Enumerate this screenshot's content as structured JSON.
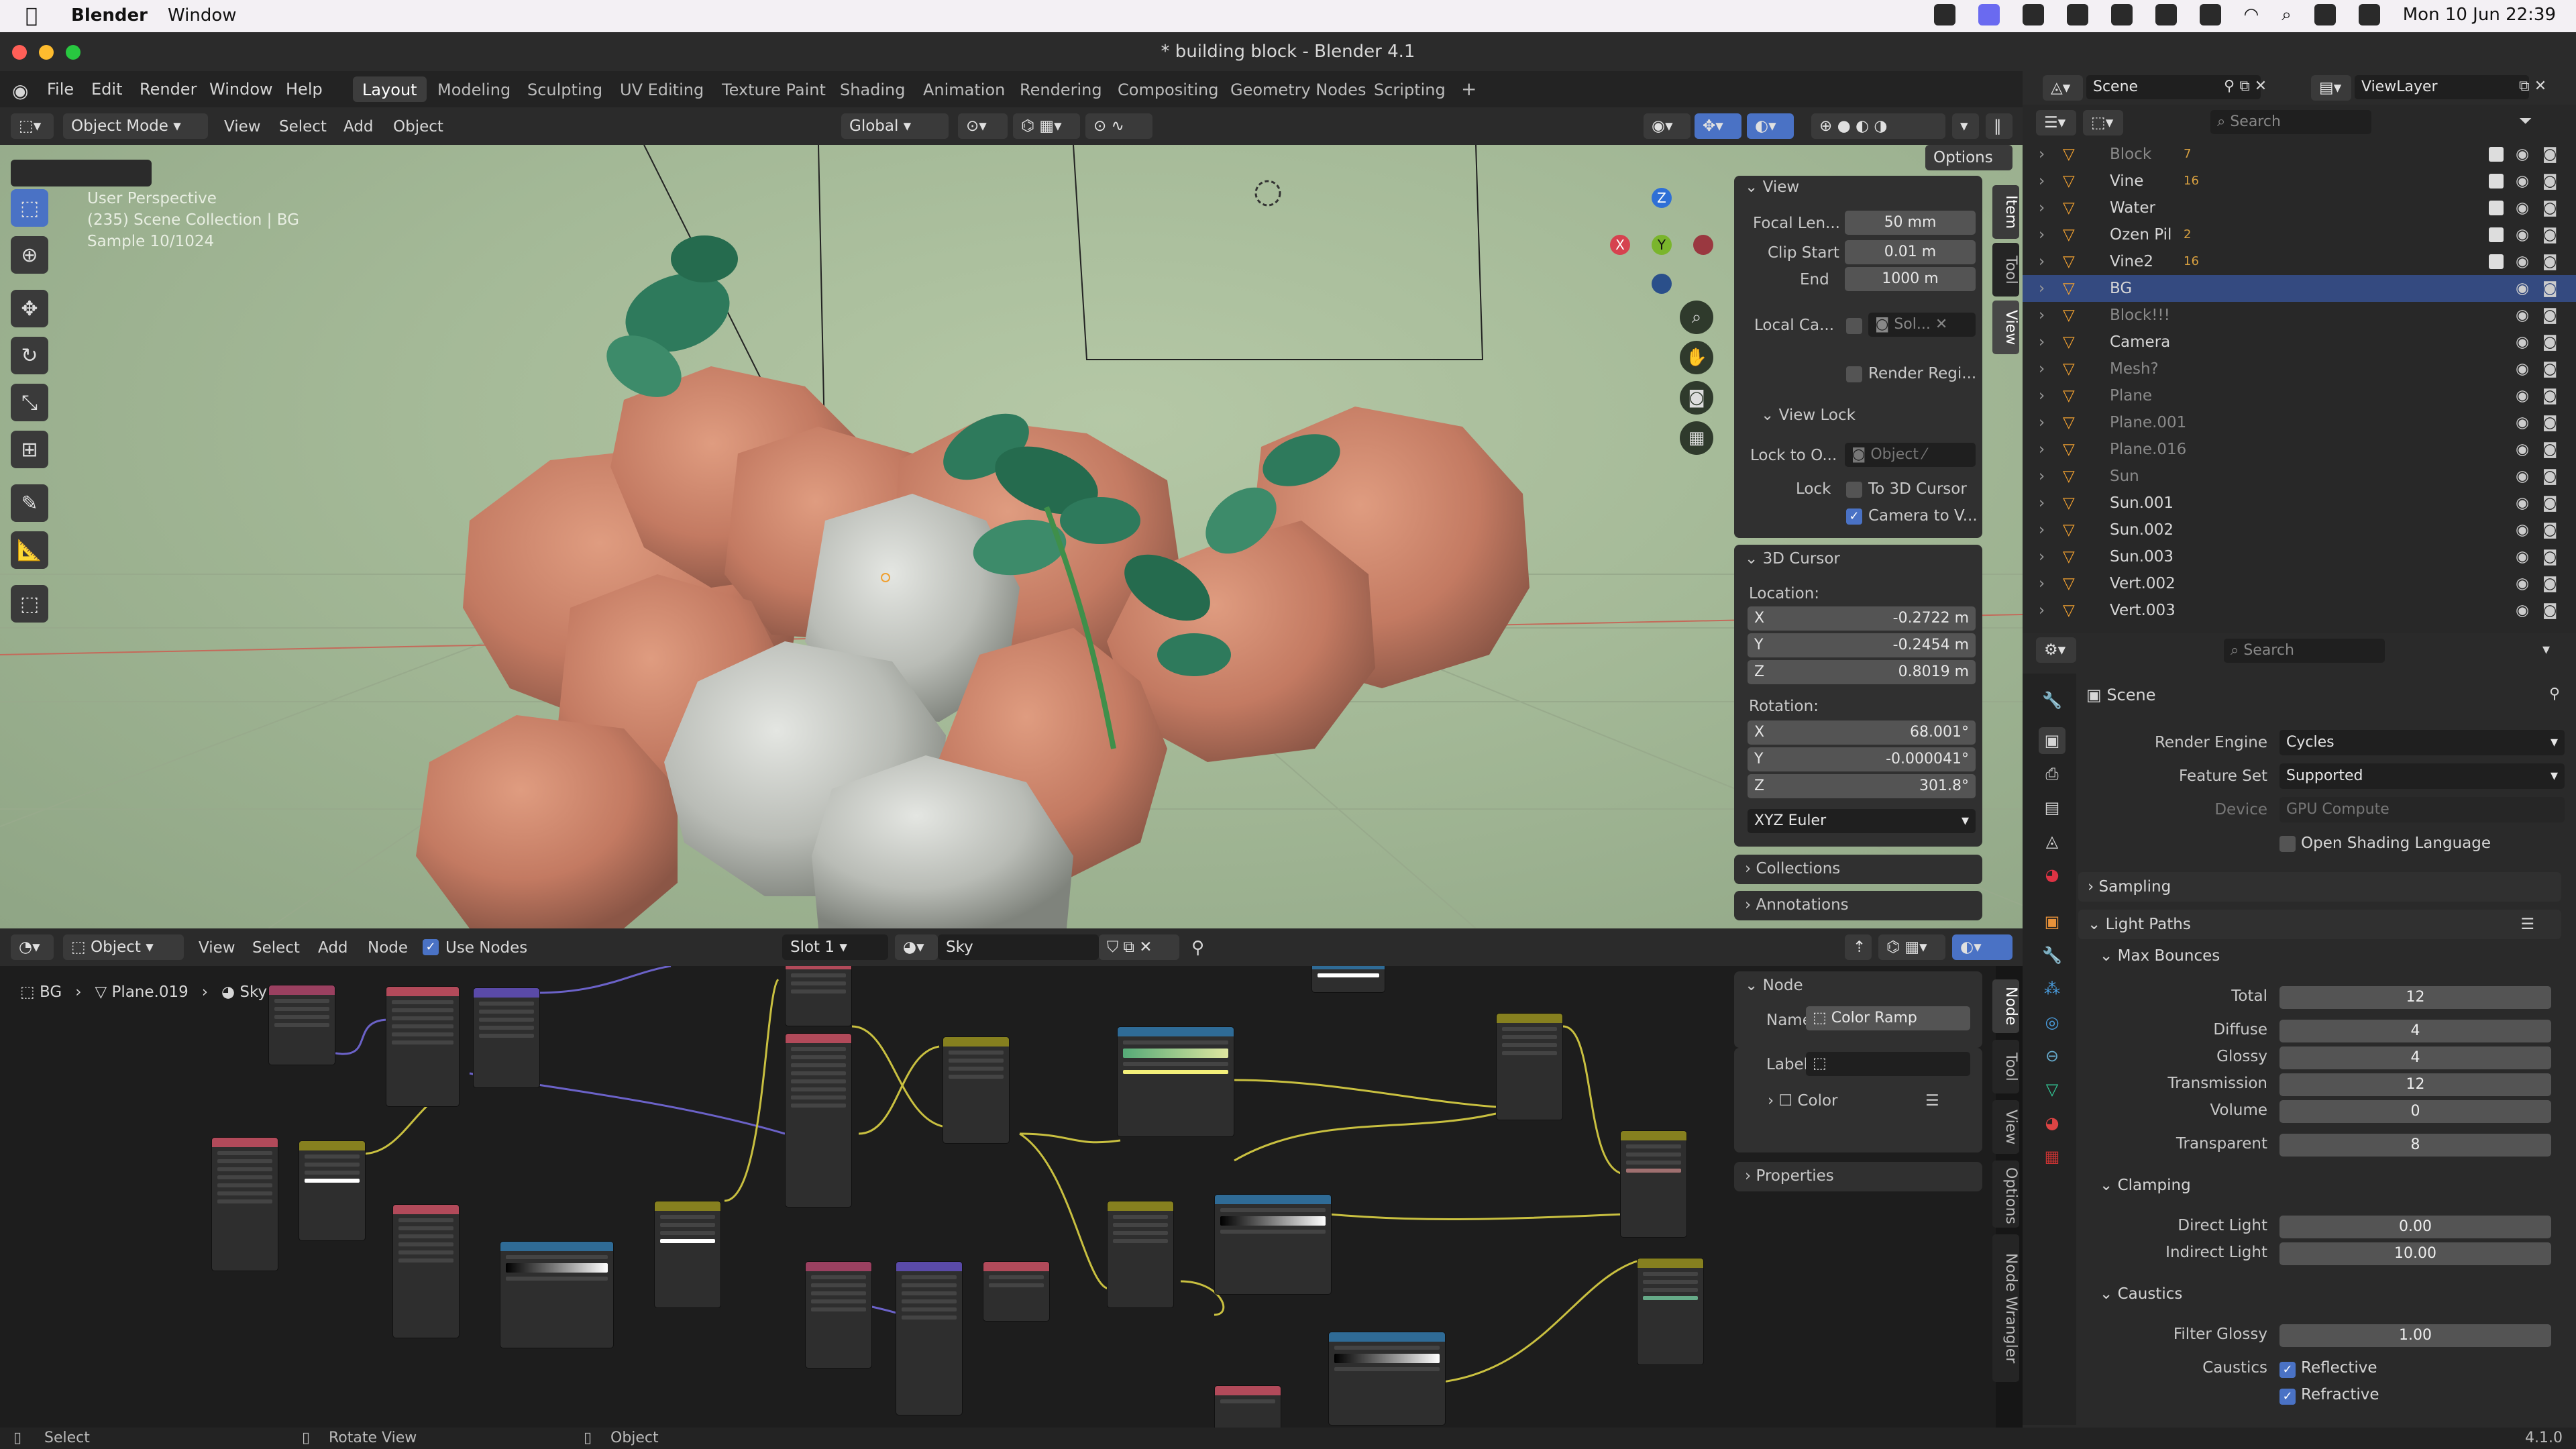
{
  "macbar": {
    "app": "Blender",
    "menu": "Window",
    "datetime": "Mon 10 Jun  22:39"
  },
  "title": "* building block - Blender 4.1",
  "topmenu": {
    "items": [
      "File",
      "Edit",
      "Render",
      "Window",
      "Help"
    ],
    "workspaces": [
      "Layout",
      "Modeling",
      "Sculpting",
      "UV Editing",
      "Texture Paint",
      "Shading",
      "Animation",
      "Rendering",
      "Compositing",
      "Geometry Nodes",
      "Scripting"
    ],
    "active_workspace": "Layout"
  },
  "viewport": {
    "mode": "Object Mode",
    "menus": [
      "View",
      "Select",
      "Add",
      "Object"
    ],
    "orientation": "Global",
    "options": "Options",
    "overlay_lines": [
      "User Perspective",
      "(235) Scene Collection | BG",
      "Sample 10/1024"
    ],
    "gizmo": {
      "x": "X",
      "y": "Y",
      "z": "Z"
    }
  },
  "npanel": {
    "view_header": "View",
    "focal_label": "Focal Len...",
    "focal": "50 mm",
    "clip_start_label": "Clip Start",
    "clip_start": "0.01 m",
    "end_label": "End",
    "end": "1000 m",
    "local_cam_label": "Local Ca...",
    "local_cam_value": "Sol...",
    "render_region": "Render Regi...",
    "view_lock": "View Lock",
    "lock_obj_label": "Lock to O...",
    "lock_obj_placeholder": "Object",
    "lock_label": "Lock",
    "to_cursor": "To 3D Cursor",
    "cam_to_view": "Camera to V...",
    "cursor_header": "3D Cursor",
    "location": "Location:",
    "loc_x": "-0.2722 m",
    "loc_y": "-0.2454 m",
    "loc_z": "0.8019 m",
    "rotation": "Rotation:",
    "rot_x": "68.001°",
    "rot_y": "-0.000041°",
    "rot_z": "301.8°",
    "rot_mode": "XYZ Euler",
    "collections": "Collections",
    "annotations": "Annotations",
    "tabs": [
      "Item",
      "Tool",
      "View"
    ]
  },
  "nodeeditor": {
    "type": "Object",
    "menus": [
      "View",
      "Select",
      "Add",
      "Node"
    ],
    "use_nodes": "Use Nodes",
    "slot": "Slot 1",
    "world": "Sky",
    "breadcrumb": [
      "BG",
      "Plane.019",
      "Sky"
    ],
    "node_header": "Node",
    "name_label": "Name:",
    "name_value": "Color Ramp",
    "label_label": "Label:",
    "color": "Color",
    "properties": "Properties",
    "tabs": [
      "Node",
      "Tool",
      "View",
      "Options",
      "Node Wrangler"
    ]
  },
  "outliner": {
    "scene": "Scene",
    "viewlayer": "ViewLayer",
    "search": "Search",
    "items": [
      {
        "name": "Block",
        "badge": "7",
        "dim": true
      },
      {
        "name": "Vine",
        "badge": "16",
        "dim": false
      },
      {
        "name": "Water",
        "badge": "",
        "dim": false
      },
      {
        "name": "Ozen Pil",
        "badge": "2",
        "dim": false
      },
      {
        "name": "Vine2",
        "badge": "16",
        "dim": false
      },
      {
        "name": "BG",
        "badge": "",
        "dim": false,
        "selected": true
      },
      {
        "name": "Block!!!",
        "badge": "",
        "dim": true
      },
      {
        "name": "Camera",
        "badge": "",
        "dim": false
      },
      {
        "name": "Mesh?",
        "badge": "",
        "dim": true
      },
      {
        "name": "Plane",
        "badge": "",
        "dim": true
      },
      {
        "name": "Plane.001",
        "badge": "",
        "dim": true
      },
      {
        "name": "Plane.016",
        "badge": "",
        "dim": true
      },
      {
        "name": "Sun",
        "badge": "",
        "dim": true
      },
      {
        "name": "Sun.001",
        "badge": "",
        "dim": false
      },
      {
        "name": "Sun.002",
        "badge": "",
        "dim": false
      },
      {
        "name": "Sun.003",
        "badge": "",
        "dim": false
      },
      {
        "name": "Vert.002",
        "badge": "",
        "dim": false
      },
      {
        "name": "Vert.003",
        "badge": "",
        "dim": false
      }
    ]
  },
  "properties": {
    "search": "Search",
    "scene": "Scene",
    "render_engine_label": "Render Engine",
    "render_engine": "Cycles",
    "feature_set_label": "Feature Set",
    "feature_set": "Supported",
    "device_label": "Device",
    "device": "GPU Compute",
    "osl": "Open Shading Language",
    "sampling": "Sampling",
    "light_paths": "Light Paths",
    "max_bounces": "Max Bounces",
    "total_label": "Total",
    "total": "12",
    "diffuse_label": "Diffuse",
    "diffuse": "4",
    "glossy_label": "Glossy",
    "glossy": "4",
    "transmission_label": "Transmission",
    "transmission": "12",
    "volume_label": "Volume",
    "volume": "0",
    "transparent_label": "Transparent",
    "transparent": "8",
    "clamping": "Clamping",
    "direct_label": "Direct Light",
    "direct": "0.00",
    "indirect_label": "Indirect Light",
    "indirect": "10.00",
    "caustics": "Caustics",
    "filter_glossy_label": "Filter Glossy",
    "filter_glossy": "1.00",
    "caustics_label": "Caustics",
    "reflective": "Reflective",
    "refractive": "Refractive"
  },
  "status": {
    "select": "Select",
    "rotate": "Rotate View",
    "object": "Object",
    "version": "4.1.0"
  }
}
